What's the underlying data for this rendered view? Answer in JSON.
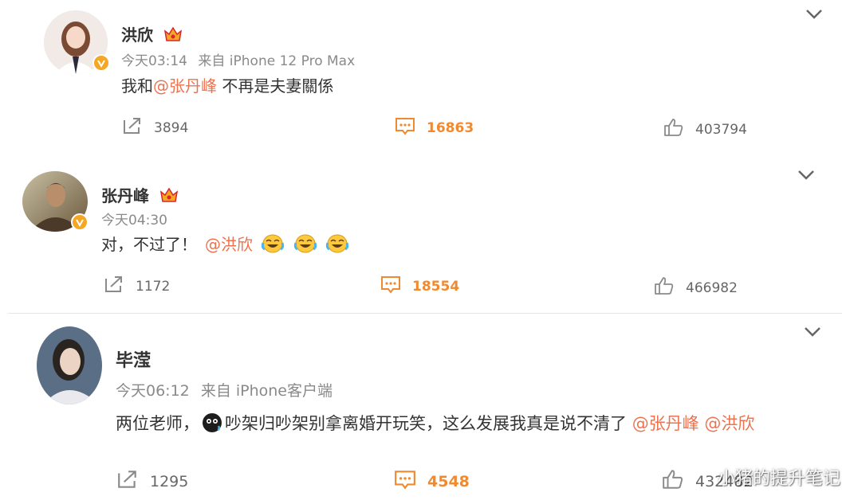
{
  "posts": [
    {
      "name": "洪欣",
      "time": "今天03:14",
      "source": "来自 iPhone 12 Pro Max",
      "text_before": "我和",
      "mention1": "@张丹峰",
      "text_after": " 不再是夫妻關係",
      "reposts": "3894",
      "comments": "16863",
      "likes": "403794"
    },
    {
      "name": "张丹峰",
      "time": "今天04:30",
      "source": "",
      "text_before": "对，不过了！",
      "mention1": "@洪欣",
      "text_after": "",
      "reposts": "1172",
      "comments": "18554",
      "likes": "466982"
    },
    {
      "name": "毕滢",
      "time": "今天06:12",
      "source": "来自 iPhone客户端",
      "text_before": "两位老师，",
      "text_middle": "吵架归吵架别拿离婚开玩笑，这么发展我真是说不清了",
      "mention1": "@张丹峰",
      "mention2": "@洪欣",
      "reposts": "1295",
      "comments": "4548",
      "likes": "432482"
    }
  ],
  "watermark": "小猪的提升笔记",
  "colors": {
    "accent": "#eb7350",
    "comment": "#f08a31",
    "badge": "#f5a623"
  },
  "icons": [
    "repost-icon",
    "comment-icon",
    "like-icon",
    "chevron-down-icon",
    "crown-icon",
    "verified-icon",
    "laugh-cry-emoji"
  ]
}
